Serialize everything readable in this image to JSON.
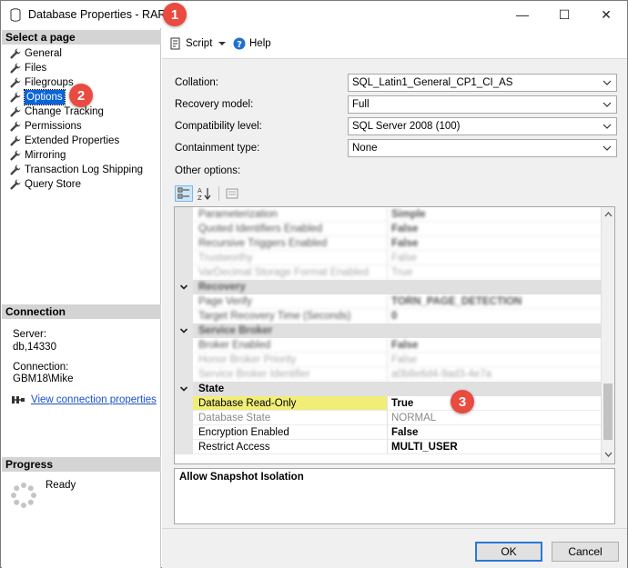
{
  "window": {
    "title": "Database Properties - RAR",
    "minimize": "—",
    "maximize": "☐",
    "close": "✕"
  },
  "badges": [
    "1",
    "2",
    "3"
  ],
  "left": {
    "select_page_header": "Select a page",
    "pages": [
      {
        "label": "General"
      },
      {
        "label": "Files"
      },
      {
        "label": "Filegroups"
      },
      {
        "label": "Options",
        "selected": true
      },
      {
        "label": "Change Tracking"
      },
      {
        "label": "Permissions"
      },
      {
        "label": "Extended Properties"
      },
      {
        "label": "Mirroring"
      },
      {
        "label": "Transaction Log Shipping"
      },
      {
        "label": "Query Store"
      }
    ],
    "connection_header": "Connection",
    "server_label": "Server:",
    "server_value": "db,14330",
    "connection_label": "Connection:",
    "connection_value": "GBM18\\Mike",
    "view_connection_link": "View connection properties",
    "progress_header": "Progress",
    "progress_status": "Ready"
  },
  "toolbar": {
    "script_label": "Script",
    "help_label": "Help"
  },
  "form": {
    "collation_label": "Collation:",
    "collation_value": "SQL_Latin1_General_CP1_CI_AS",
    "recovery_label": "Recovery model:",
    "recovery_value": "Full",
    "compat_label": "Compatibility level:",
    "compat_value": "SQL Server 2008 (100)",
    "containment_label": "Containment type:",
    "containment_value": "None",
    "other_options_label": "Other options:"
  },
  "grid": {
    "rows": [
      {
        "kind": "prop",
        "name": "Parameterization",
        "value": "Simple",
        "blurred": true
      },
      {
        "kind": "prop",
        "name": "Quoted Identifiers Enabled",
        "value": "False",
        "blurred": true
      },
      {
        "kind": "prop",
        "name": "Recursive Triggers Enabled",
        "value": "False",
        "blurred": true
      },
      {
        "kind": "prop",
        "name": "Trustworthy",
        "value": "False",
        "blurred": true,
        "dim": true
      },
      {
        "kind": "prop",
        "name": "VarDecimal Storage Format Enabled",
        "value": "True",
        "blurred": true,
        "dim": true
      },
      {
        "kind": "cat",
        "name": "Recovery",
        "blurred": true
      },
      {
        "kind": "prop",
        "name": "Page Verify",
        "value": "TORN_PAGE_DETECTION",
        "blurred": true
      },
      {
        "kind": "prop",
        "name": "Target Recovery Time (Seconds)",
        "value": "0",
        "blurred": true
      },
      {
        "kind": "cat",
        "name": "Service Broker",
        "blurred": true
      },
      {
        "kind": "prop",
        "name": "Broker Enabled",
        "value": "False",
        "blurred": true
      },
      {
        "kind": "prop",
        "name": "Honor Broker Priority",
        "value": "False",
        "blurred": true,
        "dim": true
      },
      {
        "kind": "prop",
        "name": "Service Broker Identifier",
        "value": "a0b8e6d4-9ad3-4e7a",
        "blurred": true,
        "dim": true
      },
      {
        "kind": "cat",
        "name": "State",
        "highlight": true
      },
      {
        "kind": "prop",
        "name": "Database Read-Only",
        "value": "True",
        "highlight": true,
        "bold_value": true
      },
      {
        "kind": "prop",
        "name": "Database State",
        "value": "NORMAL",
        "dim": true
      },
      {
        "kind": "prop",
        "name": "Encryption Enabled",
        "value": "False",
        "bold_value": true
      },
      {
        "kind": "prop",
        "name": "Restrict Access",
        "value": "MULTI_USER",
        "bold_value": true
      }
    ]
  },
  "description": "Allow Snapshot Isolation",
  "buttons": {
    "ok": "OK",
    "cancel": "Cancel"
  },
  "colors": {
    "selection": "#0a64d8",
    "highlight": "#f1ee78",
    "badge": "#ea4a3f",
    "link": "#1b4fcc"
  }
}
